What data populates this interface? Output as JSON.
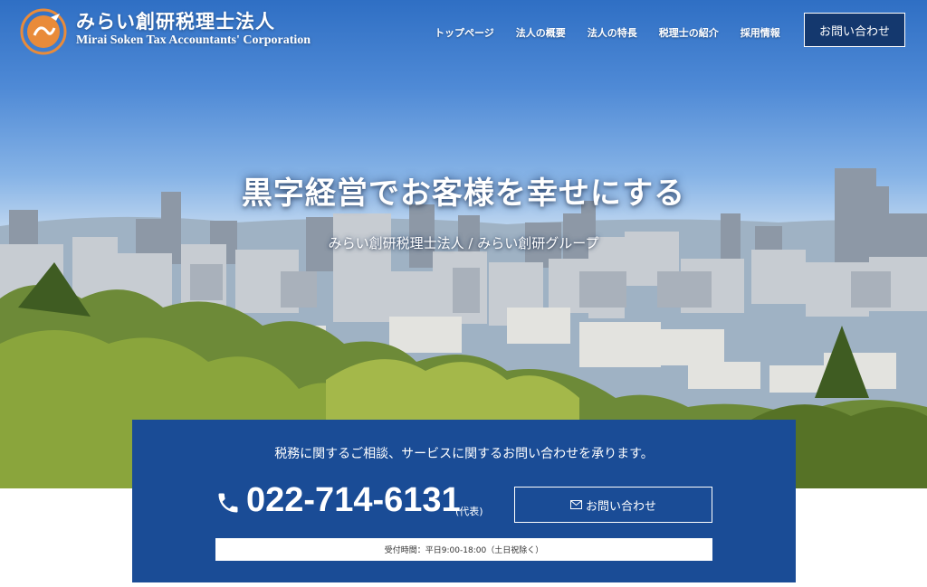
{
  "header": {
    "brand_jp": "みらい創研税理士法人",
    "brand_en": "Mirai Soken Tax Accountants' Corporation",
    "nav": [
      "トップページ",
      "法人の概要",
      "法人の特長",
      "税理士の紹介",
      "採用情報"
    ],
    "contact_label": "お問い合わせ"
  },
  "hero": {
    "catch": "黒字経営でお客様を幸せにする",
    "subcatch": "みらい創研税理士法人 / みらい創研グループ"
  },
  "contact_box": {
    "lead": "税務に関するご相談、サービスに関するお問い合わせを承ります。",
    "phone": "022-714-6131",
    "phone_note": "(代表)",
    "button_label": "お問い合わせ",
    "hours": "受付時間：平日9:00-18:00（土日祝除く）"
  },
  "colors": {
    "navy": "#1a4c96",
    "button_navy": "#14386e",
    "logo_orange": "#e98b3a"
  },
  "icons": {
    "logo": "mirai-soken-logo",
    "phone": "phone-icon",
    "mail": "mail-icon"
  }
}
